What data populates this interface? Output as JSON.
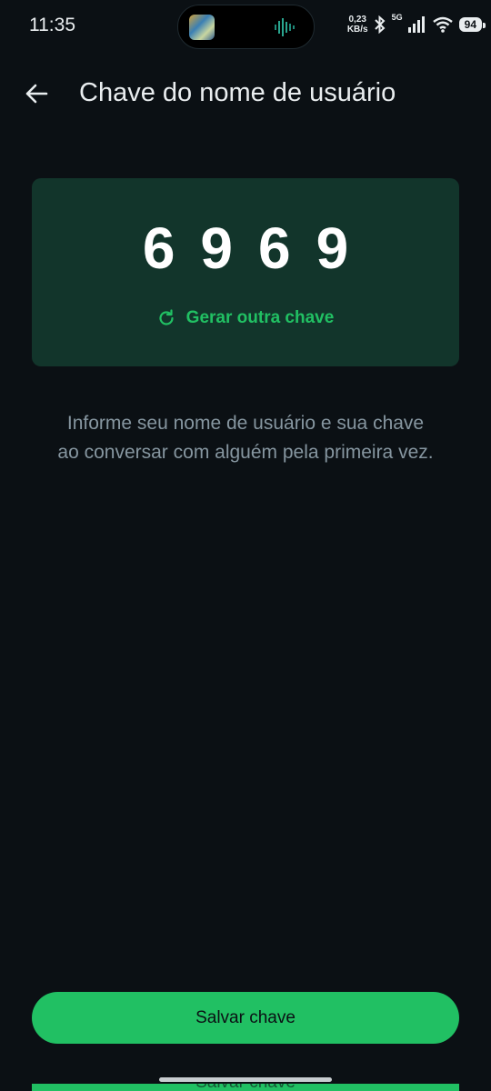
{
  "status_bar": {
    "time": "11:35",
    "net_speed_value": "0,23",
    "net_speed_unit": "KB/s",
    "network": "5G",
    "battery": "94"
  },
  "header": {
    "title": "Chave do nome de usuário"
  },
  "key_card": {
    "digits": [
      "6",
      "9",
      "6",
      "9"
    ],
    "regenerate_label": "Gerar outra chave"
  },
  "info_text_line1": "Informe seu nome de usuário e sua chave",
  "info_text_line2": "ao conversar com alguém pela primeira vez.",
  "footer": {
    "save_label": "Salvar chave"
  },
  "colors": {
    "background": "#0b1014",
    "card": "#12352b",
    "accent": "#21c063",
    "secondary_text": "#8696a0"
  }
}
